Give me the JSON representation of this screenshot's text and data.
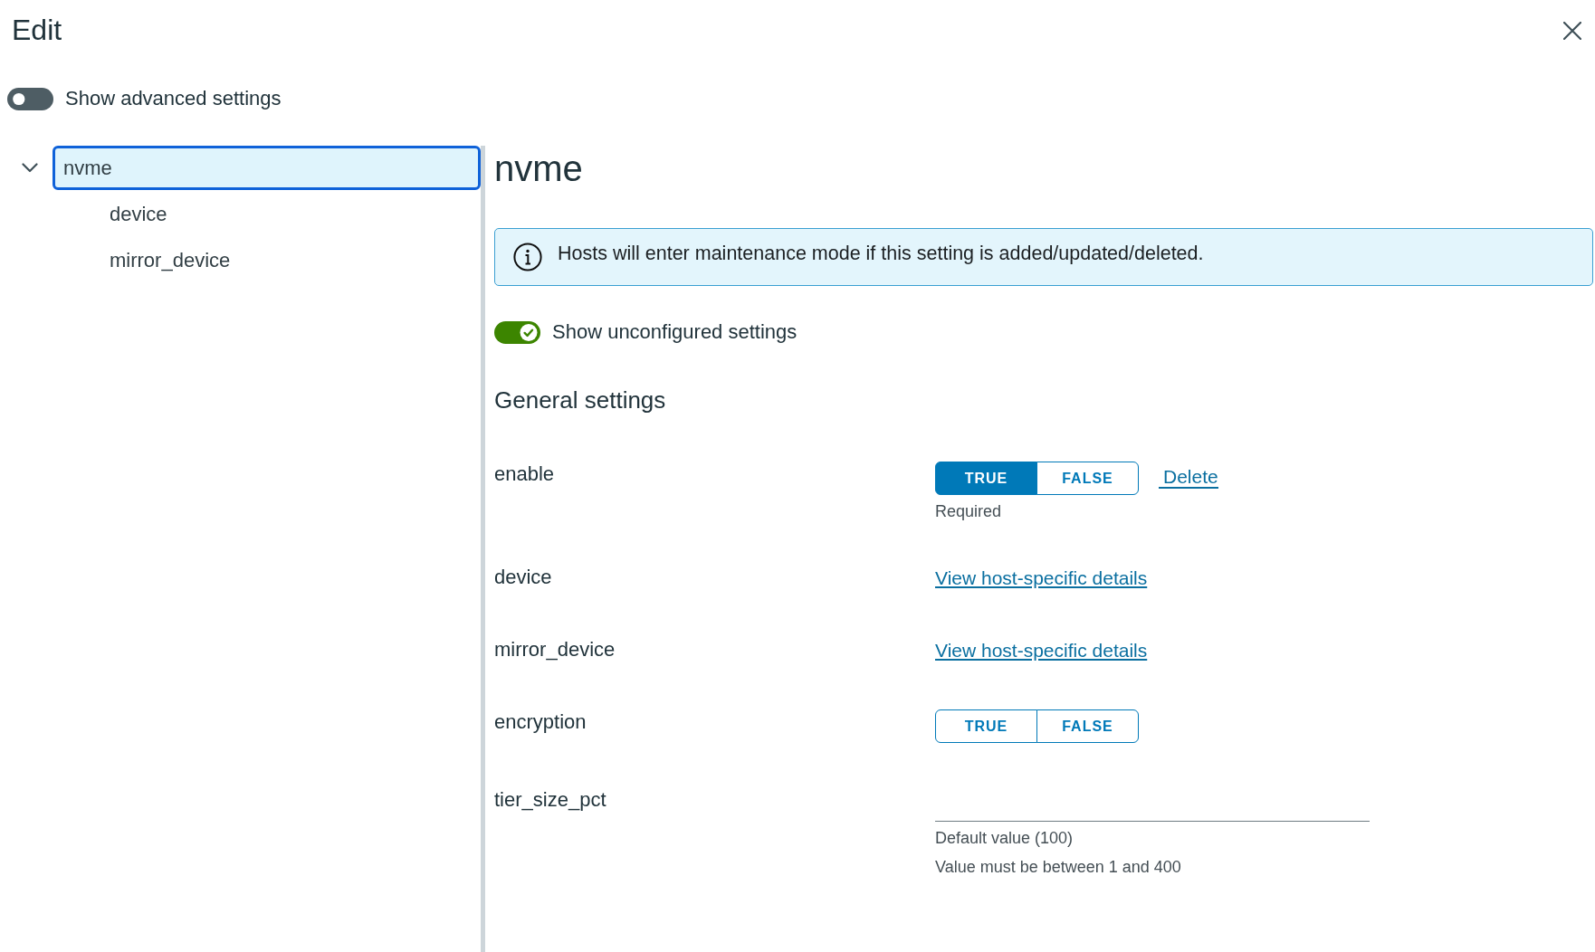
{
  "dialog": {
    "title": "Edit"
  },
  "advanced_toggle": {
    "label": "Show advanced settings",
    "on": false
  },
  "tree": [
    {
      "label": "nvme",
      "expanded": true,
      "selected": true,
      "children": [
        {
          "label": "device",
          "selected": false
        },
        {
          "label": "mirror_device",
          "selected": false
        }
      ]
    }
  ],
  "detail": {
    "title": "nvme",
    "notice": "Hosts will enter maintenance mode if this setting is added/updated/deleted.",
    "unconfigured_toggle": {
      "label": "Show unconfigured settings",
      "on": true
    },
    "section_title": "General settings",
    "settings": [
      {
        "kind": "boolean",
        "name": "enable",
        "options": [
          {
            "label": "TRUE",
            "selected": true
          },
          {
            "label": "FALSE",
            "selected": false
          }
        ],
        "action": "Delete",
        "hints": [
          "Required"
        ]
      },
      {
        "kind": "link",
        "name": "device",
        "link": "View host-specific details"
      },
      {
        "kind": "link",
        "name": "mirror_device",
        "link": "View host-specific details"
      },
      {
        "kind": "boolean",
        "name": "encryption",
        "options": [
          {
            "label": "TRUE",
            "selected": false
          },
          {
            "label": "FALSE",
            "selected": false
          }
        ]
      },
      {
        "kind": "number",
        "name": "tier_size_pct",
        "hints": [
          "Default value (100)",
          "Value must be between 1 and 400"
        ]
      }
    ]
  }
}
